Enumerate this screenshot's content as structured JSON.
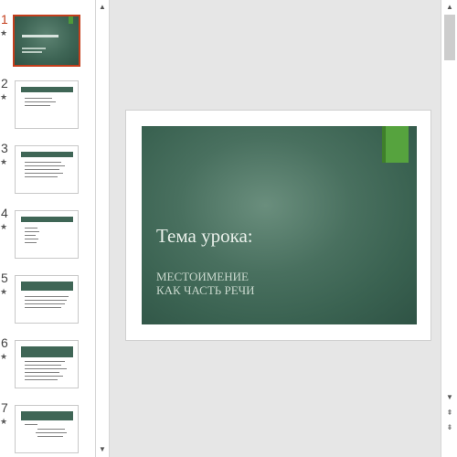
{
  "thumbnails": [
    {
      "number": "1",
      "star": "★",
      "layout": "title"
    },
    {
      "number": "2",
      "star": "★",
      "layout": "content"
    },
    {
      "number": "3",
      "star": "★",
      "layout": "content"
    },
    {
      "number": "4",
      "star": "★",
      "layout": "content"
    },
    {
      "number": "5",
      "star": "★",
      "layout": "content"
    },
    {
      "number": "6",
      "star": "★",
      "layout": "content"
    },
    {
      "number": "7",
      "star": "★",
      "layout": "content"
    }
  ],
  "active_slide": "1",
  "slide": {
    "title": "Тема урока:",
    "subtitle_line1": "МЕСТОИМЕНИЕ",
    "subtitle_line2": "КАК ЧАСТЬ РЕЧИ"
  },
  "colors": {
    "accent": "#c43e1c",
    "slide_bg": "#3f6656",
    "tag_green": "#56a33e"
  },
  "icons": {
    "scroll_up": "▲",
    "scroll_down": "▼",
    "prev_slide": "⇞",
    "next_slide": "⇟"
  }
}
